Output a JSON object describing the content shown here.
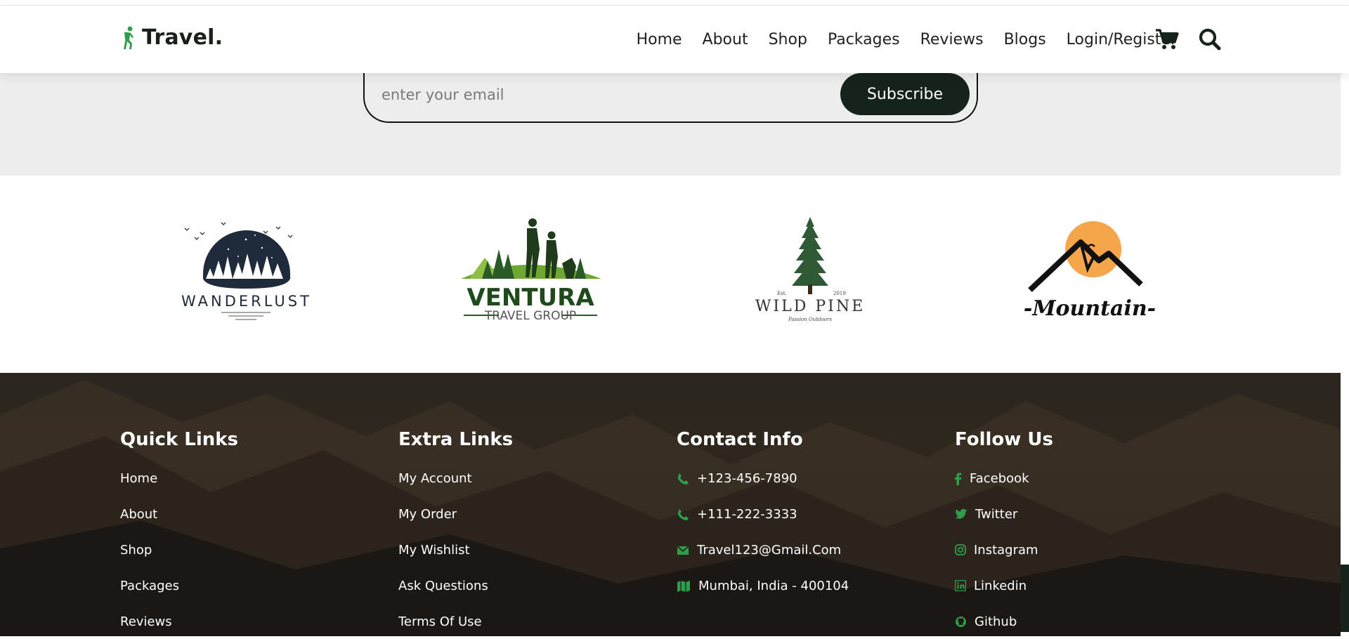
{
  "brand": {
    "name": "Travel.",
    "icon": "hiker-icon"
  },
  "nav": {
    "items": [
      "Home",
      "About",
      "Shop",
      "Packages",
      "Reviews",
      "Blogs",
      "Login/Register"
    ],
    "cart_icon": "cart-icon",
    "search_icon": "search-icon"
  },
  "newsletter": {
    "email_placeholder": "enter your email",
    "subscribe_label": "Subscribe"
  },
  "partners": {
    "wanderlust": {
      "name": "WANDERLUST"
    },
    "ventura": {
      "name": "VENTURA",
      "subtitle": "TRAVEL GROUP"
    },
    "wildpine": {
      "name": "WILD PINE",
      "est": "Est.",
      "year": "2019",
      "tagline": "Passion  Outdoors"
    },
    "mountain": {
      "name": "-Mountain-"
    }
  },
  "footer": {
    "quick_links": {
      "title": "Quick Links",
      "items": [
        "Home",
        "About",
        "Shop",
        "Packages",
        "Reviews"
      ]
    },
    "extra_links": {
      "title": "Extra Links",
      "items": [
        "My Account",
        "My Order",
        "My Wishlist",
        "Ask Questions",
        "Terms Of Use"
      ]
    },
    "contact": {
      "title": "Contact Info",
      "items": [
        {
          "icon": "phone-icon",
          "text": "+123-456-7890"
        },
        {
          "icon": "phone-icon",
          "text": "+111-222-3333"
        },
        {
          "icon": "envelope-icon",
          "text": "Travel123@Gmail.Com"
        },
        {
          "icon": "map-icon",
          "text": "Mumbai, India - 400104"
        }
      ]
    },
    "follow": {
      "title": "Follow Us",
      "items": [
        {
          "icon": "facebook-icon",
          "text": "Facebook"
        },
        {
          "icon": "twitter-icon",
          "text": "Twitter"
        },
        {
          "icon": "instagram-icon",
          "text": "Instagram"
        },
        {
          "icon": "linkedin-icon",
          "text": "Linkedin"
        },
        {
          "icon": "github-icon",
          "text": "Github"
        }
      ]
    }
  },
  "colors": {
    "accent": "#2e9e4b",
    "dark": "#16231c",
    "newsletter_bg": "#ededed"
  }
}
